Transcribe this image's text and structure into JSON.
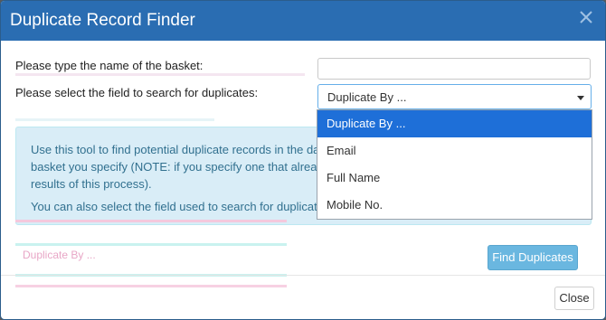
{
  "dialog": {
    "title": "Duplicate Record Finder",
    "basket_label": "Please type the name of the basket:",
    "basket_value": "",
    "field_label": "Please select the field to search for duplicates:",
    "field_value": "Duplicate By ...",
    "field_options": [
      "Duplicate By ...",
      "Email",
      "Full Name",
      "Mobile No."
    ],
    "info_lines": [
      "Use this tool to find potential duplicate records in the da",
      "basket you specify (NOTE: if you specify one that alread",
      "results of this process).",
      "You can also select the field used to search for duplicate"
    ],
    "ghost_text": "Duplicate By ...",
    "find_button": "Find Duplicates",
    "close_button": "Close"
  },
  "colors": {
    "titlebar": "#2a6db2",
    "selected_option": "#1e6fd8",
    "info_background": "#d9edf7",
    "find_button": "#6ab7e0"
  },
  "icons": {
    "close": "close-icon",
    "caret": "caret-down-icon"
  }
}
